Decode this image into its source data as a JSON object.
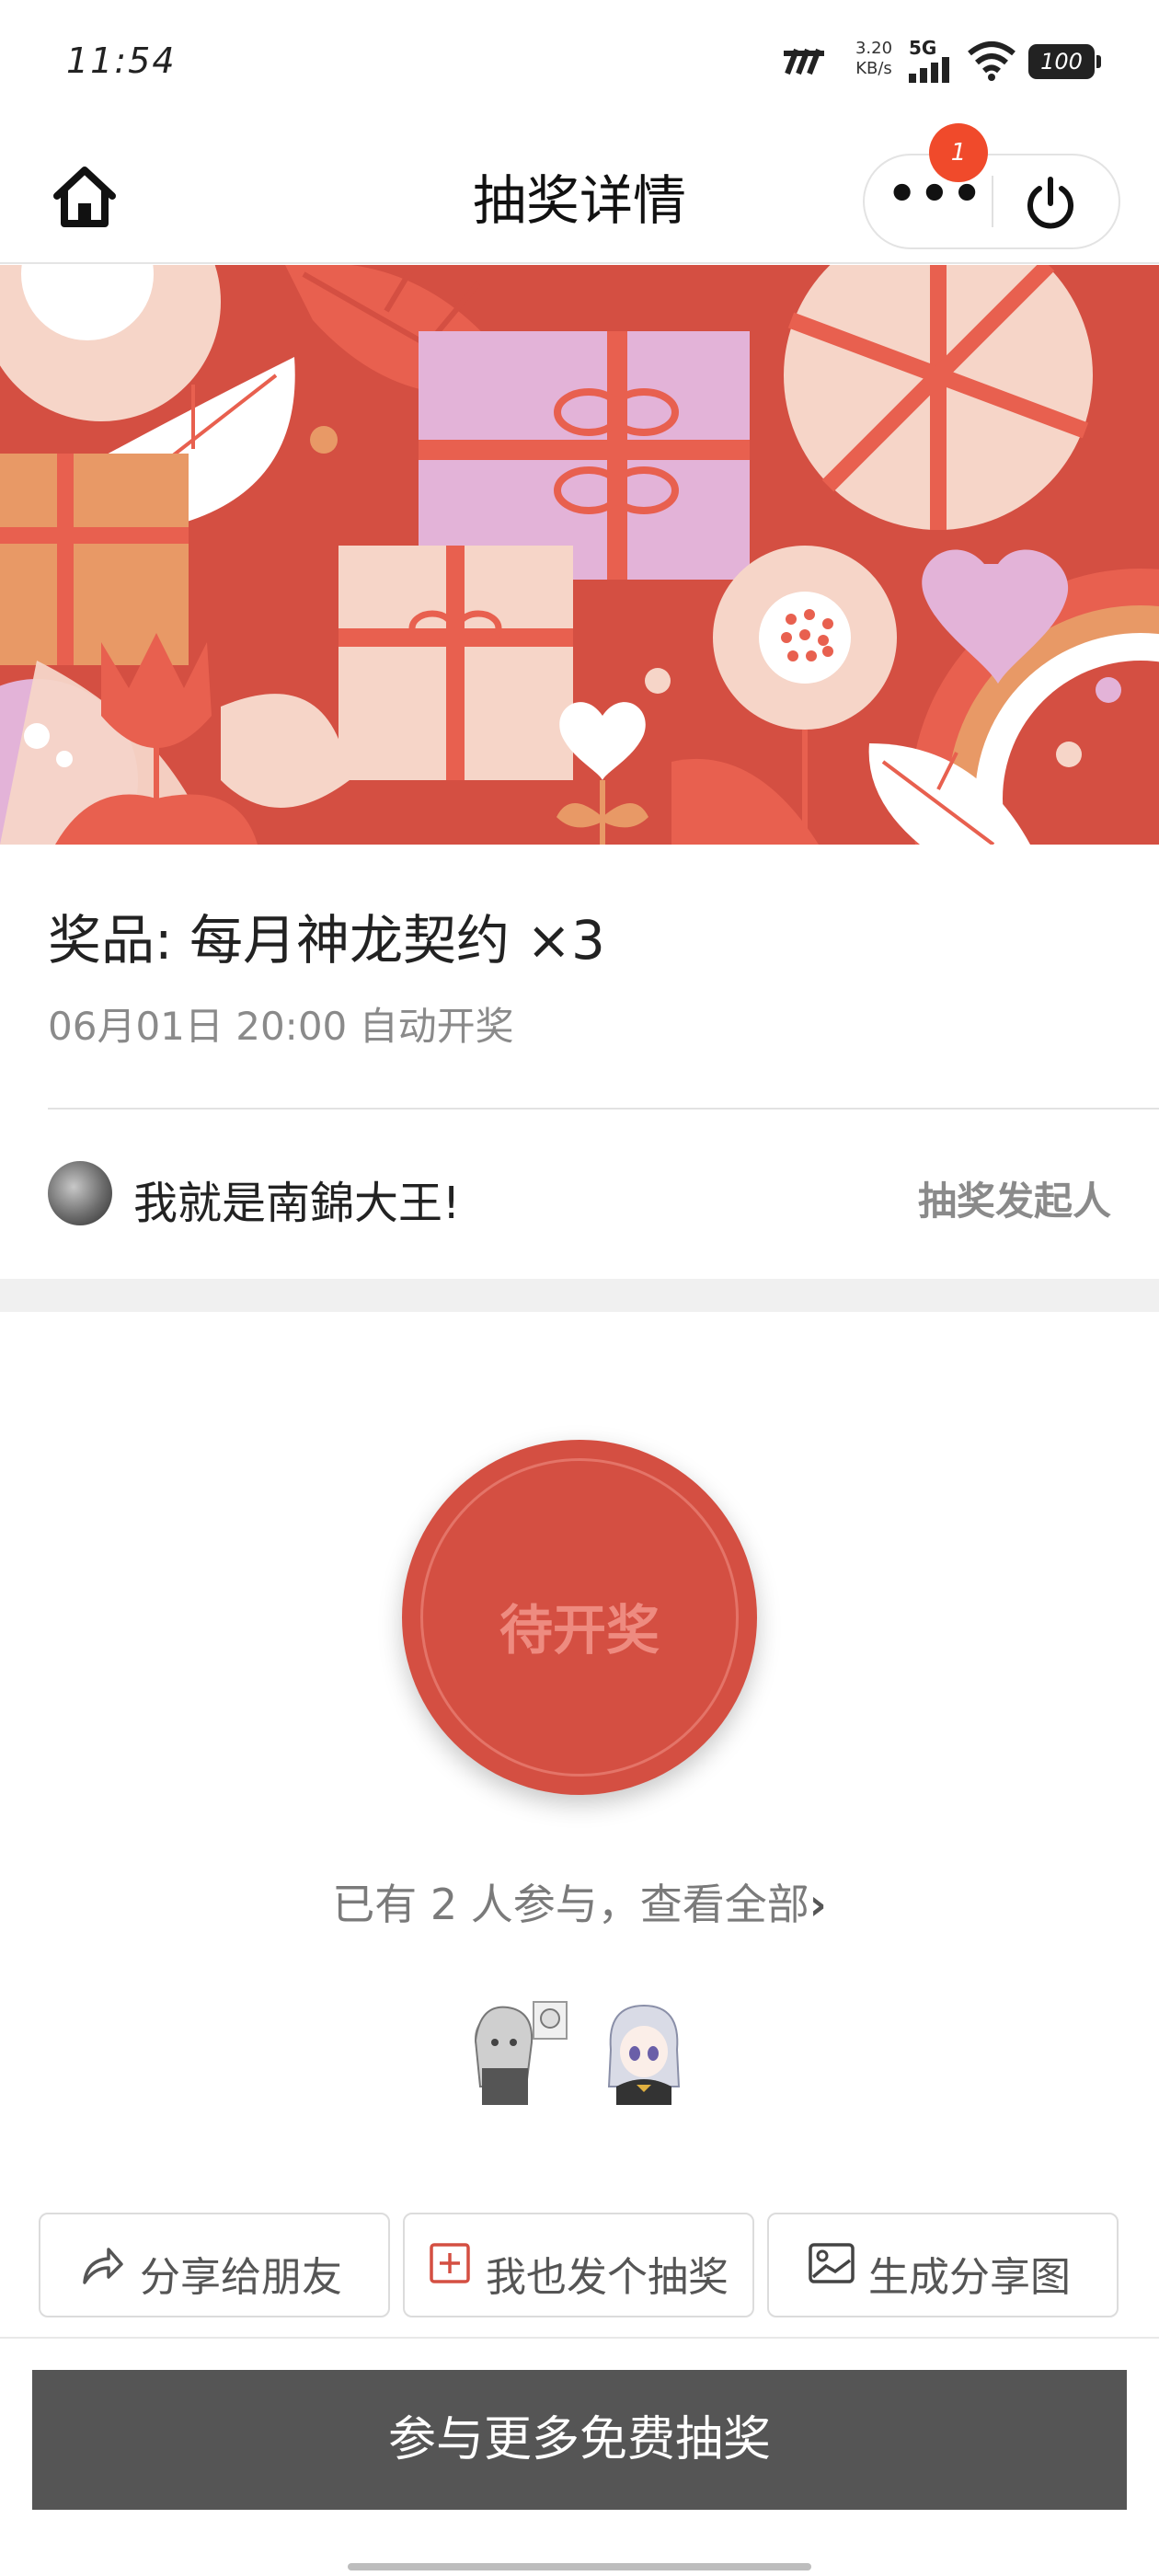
{
  "status_bar": {
    "time": "11:54",
    "net_speed_value": "3.20",
    "net_speed_unit": "KB/s",
    "network": "5G",
    "battery": "100"
  },
  "nav": {
    "title": "抽奖详情",
    "badge_count": "1",
    "more_label": "•••"
  },
  "prize": {
    "title": "奖品: 每月神龙契约 ×3",
    "draw_time": "06月01日 20:00 自动开奖"
  },
  "sponsor": {
    "name": "我就是南錦大王!",
    "role": "抽奖发起人"
  },
  "draw": {
    "status": "待开奖"
  },
  "participants": {
    "text": "已有 2 人参与，查看全部",
    "chevron": "›"
  },
  "actions": {
    "share_friends": "分享给朋友",
    "create_lottery": "我也发个抽奖",
    "share_image": "生成分享图"
  },
  "join_more": "参与更多免费抽奖",
  "colors": {
    "accent": "#d44f42",
    "badge": "#f04a2b",
    "button_dark": "#555555"
  }
}
